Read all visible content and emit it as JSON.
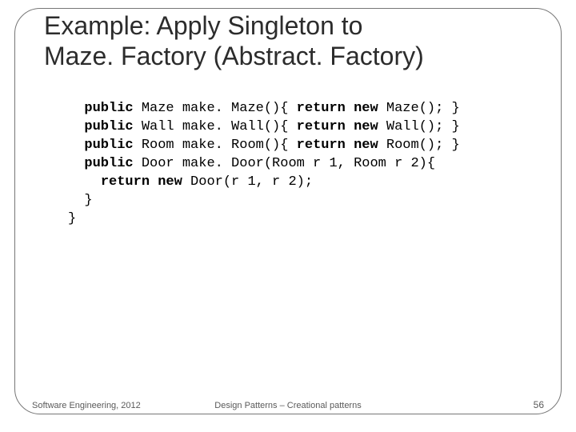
{
  "title_line1": "Example: Apply Singleton to",
  "title_line2": "Maze. Factory (Abstract. Factory)",
  "code": {
    "l1_kw1": "public",
    "l1_t1": " Maze make. Maze(){ ",
    "l1_kw2": "return new",
    "l1_t2": " Maze(); }",
    "l2_kw1": "public",
    "l2_t1": " Wall make. Wall(){ ",
    "l2_kw2": "return new",
    "l2_t2": " Wall(); }",
    "l3_kw1": "public",
    "l3_t1": " Room make. Room(){ ",
    "l3_kw2": "return new",
    "l3_t2": " Room(); }",
    "l4_kw1": "public",
    "l4_t1": " Door make. Door(Room r 1, Room r 2){",
    "l5_kw1": "return new",
    "l5_t1": " Door(r 1, r 2);",
    "l6": "  }",
    "l7": "}"
  },
  "footer": {
    "left": "Software Engineering, 2012",
    "center": "Design Patterns – Creational patterns",
    "page": "56"
  }
}
